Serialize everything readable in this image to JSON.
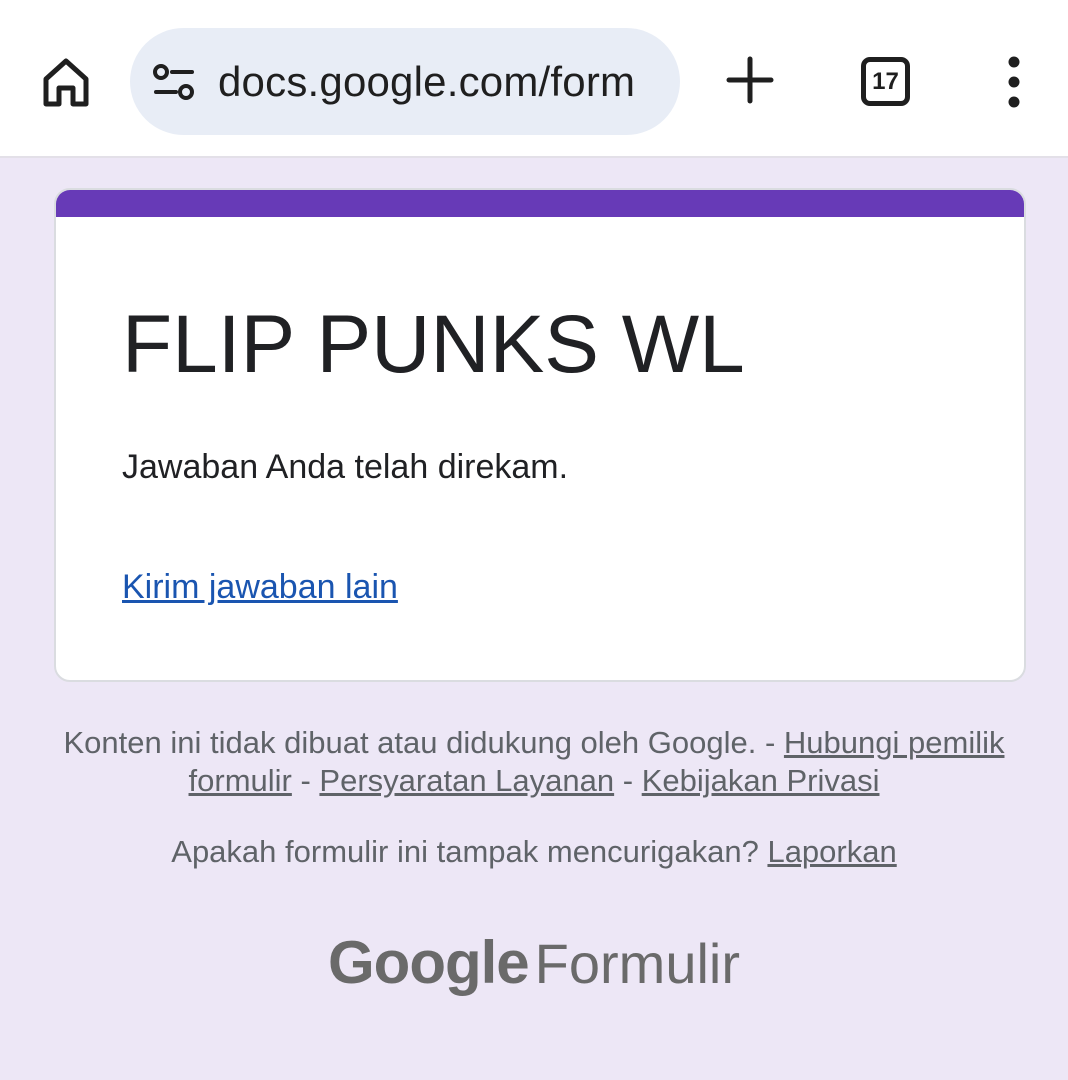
{
  "browser": {
    "url": "docs.google.com/form",
    "tab_count": "17"
  },
  "form": {
    "title": "FLIP PUNKS WL",
    "confirmation": "Jawaban Anda telah direkam.",
    "resubmit_link": "Kirim jawaban lain"
  },
  "footer": {
    "disclaimer": "Konten ini tidak dibuat atau didukung oleh Google.",
    "separator": " - ",
    "contact_owner": "Hubungi pemilik formulir",
    "terms": "Persyaratan Layanan",
    "privacy": "Kebijakan Privasi",
    "report_question": "Apakah formulir ini tampak mencurigakan?",
    "report_link": "Laporkan"
  },
  "brand": {
    "google": "Google",
    "product": "Formulir"
  },
  "colors": {
    "accent": "#673ab7",
    "link": "#1a55b0",
    "page_bg": "#ede7f6"
  },
  "icons": [
    "home-icon",
    "tune-icon",
    "plus-icon",
    "tab-switcher-icon",
    "more-vert-icon"
  ]
}
